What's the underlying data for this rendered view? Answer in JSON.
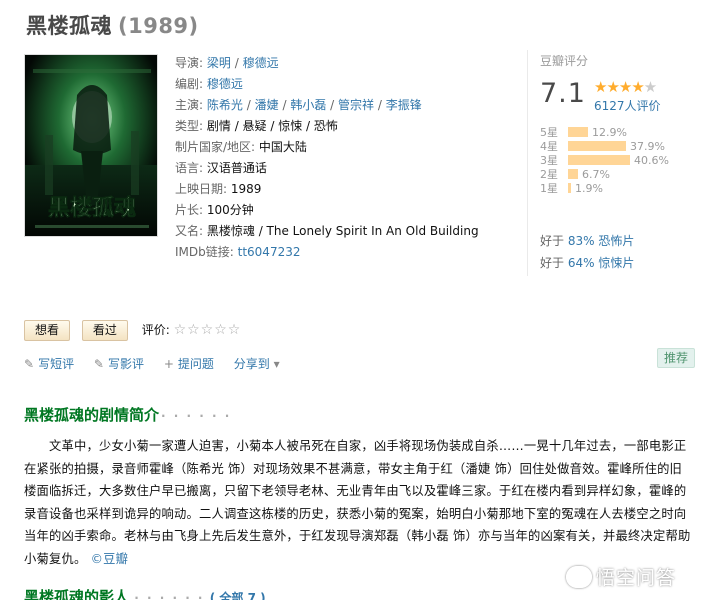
{
  "movie": {
    "title": "黑楼孤魂",
    "year": "(1989)"
  },
  "info": {
    "director_label": "导演:",
    "directors": [
      "梁明",
      "穆德远"
    ],
    "writer_label": "编剧:",
    "writers": [
      "穆德远"
    ],
    "cast_label": "主演:",
    "cast": [
      "陈希光",
      "潘婕",
      "韩小磊",
      "管宗祥",
      "李振锋"
    ],
    "genre_label": "类型:",
    "genre": "剧情 / 悬疑 / 惊悚 / 恐怖",
    "country_label": "制片国家/地区:",
    "country": "中国大陆",
    "language_label": "语言:",
    "language": "汉语普通话",
    "release_label": "上映日期:",
    "release": "1989",
    "runtime_label": "片长:",
    "runtime": "100分钟",
    "aka_label": "又名:",
    "aka": "黑楼惊魂 / The Lonely Spirit In An Old Building",
    "imdb_label": "IMDb链接:",
    "imdb": "tt6047232",
    "separator": "/"
  },
  "rating": {
    "label": "豆瓣评分",
    "score": "7.1",
    "stars_filled": "★★★★",
    "stars_empty": "★",
    "votes": "6127人评价",
    "distribution": [
      {
        "label": "5星",
        "percent": "12.9%",
        "value": 12.9
      },
      {
        "label": "4星",
        "percent": "37.9%",
        "value": 37.9
      },
      {
        "label": "3星",
        "percent": "40.6%",
        "value": 40.6
      },
      {
        "label": "2星",
        "percent": "6.7%",
        "value": 6.7
      },
      {
        "label": "1星",
        "percent": "1.9%",
        "value": 1.9
      }
    ],
    "better_than": [
      {
        "prefix": "好于",
        "percent": "83%",
        "genre": "恐怖片"
      },
      {
        "prefix": "好于",
        "percent": "64%",
        "genre": "惊悚片"
      }
    ]
  },
  "actions": {
    "want": "想看",
    "seen": "看过",
    "rate_label": "评价:",
    "rate_stars": "☆☆☆☆☆"
  },
  "tools": {
    "short_review": "写短评",
    "review": "写影评",
    "ask": "提问题",
    "share": "分享到",
    "recommend": "推荐"
  },
  "summary": {
    "title": "黑楼孤魂的剧情简介",
    "dots": "· · · · · ·",
    "text": "文革中，少女小菊一家遭人迫害，小菊本人被吊死在自家，凶手将现场伪装成自杀……一晃十几年过去，一部电影正在紧张的拍摄，录音师霍峰（陈希光 饰）对现场效果不甚满意，带女主角于红（潘婕 饰）回住处做音效。霍峰所住的旧楼面临拆迁，大多数住户早已搬离，只留下老领导老林、无业青年由飞以及霍峰三家。于红在楼内看到异样幻象，霍峰的录音设备也采样到诡异的响动。二人调查这栋楼的历史，获悉小菊的冤案，始明白小菊那地下室的冤魂在人去楼空之时向当年的凶手索命。老林与由飞身上先后发生意外，于红发现导演郑磊（韩小磊 饰）亦与当年的凶案有关，并最终决定帮助小菊复仇。",
    "source": "©豆瓣"
  },
  "cast_section": {
    "title": "黑楼孤魂的影人",
    "dots": "· · · · · ·",
    "all": "( 全部 7 )"
  },
  "watermark": "悟空问答",
  "colors": {
    "accent": "#37a",
    "section": "#072",
    "bar": "#ffd596",
    "star": "#ffac2d"
  }
}
